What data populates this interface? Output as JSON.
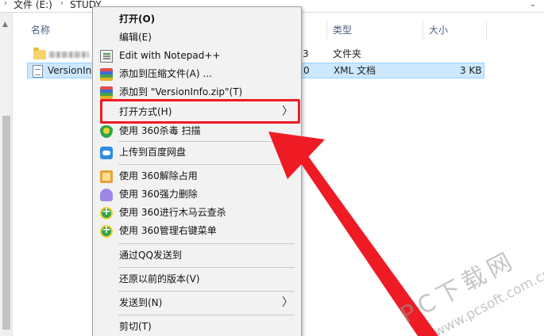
{
  "address_bar": {
    "crumbs": [
      "文件 (E:)",
      "STUDY"
    ],
    "sep_glyph": "›",
    "dropdown_glyph": "⌄"
  },
  "columns": {
    "name": "名称",
    "type": "类型",
    "size": "大小"
  },
  "files": [
    {
      "name_visible": "",
      "date_fragment": "3",
      "type": "文件夹",
      "size": "",
      "icon": "folder-icon",
      "selected": false
    },
    {
      "name_visible": "VersionIn",
      "date_fragment": "0",
      "type": "XML 文档",
      "size": "3 KB",
      "icon": "xml-file-icon",
      "selected": true
    }
  ],
  "context_menu": {
    "items": [
      {
        "label": "打开(O)",
        "bold": true,
        "icon": ""
      },
      {
        "label": "编辑(E)",
        "icon": ""
      },
      {
        "label": "Edit with Notepad++",
        "icon": "notepad-icon"
      },
      {
        "label": "添加到压缩文件(A) ...",
        "icon": "winrar-icon"
      },
      {
        "label": "添加到 \"VersionInfo.zip\"(T)",
        "icon": "winrar-icon"
      },
      {
        "label": "打开方式(H)",
        "icon": "",
        "submenu_glyph": "〉"
      },
      {
        "label": "使用 360杀毒 扫描",
        "icon": "360-antivirus-icon"
      },
      {
        "label": "上传到百度网盘",
        "icon": "baidu-cloud-icon"
      },
      {
        "label": "使用 360解除占用",
        "icon": "360-unlock-icon"
      },
      {
        "label": "使用 360强力删除",
        "icon": "360-shred-icon"
      },
      {
        "label": "使用 360进行木马云查杀",
        "icon": "360-trojan-icon"
      },
      {
        "label": "使用 360管理右键菜单",
        "icon": "360-trojan-icon"
      },
      {
        "label": "通过QQ发送到",
        "icon": ""
      },
      {
        "label": "还原以前的版本(V)",
        "icon": ""
      },
      {
        "label": "发送到(N)",
        "icon": "",
        "submenu_glyph": "〉"
      },
      {
        "label": "剪切(T)",
        "icon": ""
      }
    ]
  },
  "annotation": {
    "color": "#ee1b24"
  },
  "watermark": {
    "main": "PC下载网",
    "sub": "www.pcsoft.com.cn"
  },
  "colors": {
    "selection_bg": "#cce8ff",
    "selection_border": "#99d1ff",
    "menu_bg": "#f2f2f2",
    "header_text": "#4d6082"
  }
}
